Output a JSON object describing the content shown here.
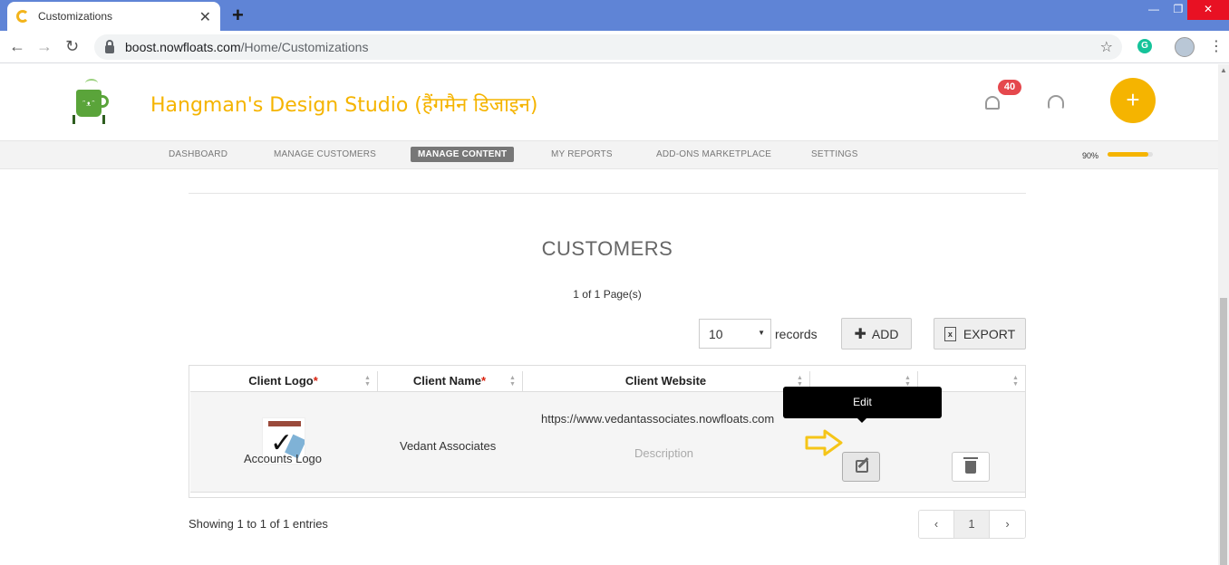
{
  "browser": {
    "tab_title": "Customizations",
    "url_host": "boost.nowfloats.com",
    "url_path": "/Home/Customizations",
    "extension_letter": "G"
  },
  "header": {
    "business_name": "Hangman's Design Studio (हैंगमैन डिजाइन)",
    "notifications_count": "40",
    "fab_label": "+"
  },
  "nav": {
    "items": [
      {
        "label": "DASHBOARD"
      },
      {
        "label": "MANAGE CUSTOMERS"
      },
      {
        "label": "MANAGE CONTENT"
      },
      {
        "label": "MY REPORTS"
      },
      {
        "label": "ADD-ONS MARKETPLACE"
      },
      {
        "label": "SETTINGS"
      }
    ],
    "active_index": 2,
    "progress_label": "90%",
    "progress_value": 0.9
  },
  "content": {
    "title": "CUSTOMERS",
    "page_current": "1",
    "page_of": "of",
    "page_total": "1",
    "page_suffix": "Page(s)",
    "records_value": "10",
    "records_label": "records",
    "add_label": "ADD",
    "export_label": "EXPORT"
  },
  "table": {
    "headers": {
      "logo": "Client Logo",
      "name": "Client Name",
      "website": "Client Website",
      "required_mark": "*"
    },
    "rows": [
      {
        "logo_label": "Accounts Logo",
        "name": "Vedant Associates",
        "website": "https://www.vedantassociates.nowfloats.com",
        "description": "Description"
      }
    ],
    "tooltip": "Edit"
  },
  "footer": {
    "showing": "Showing 1 to 1 of 1 entries",
    "pager_prev": "‹",
    "pager_current": "1",
    "pager_next": "›"
  },
  "colors": {
    "brand": "#f5b400",
    "tabbar": "#5f84d6",
    "badge": "#e5484d",
    "annotation_arrow": "#f5c518"
  }
}
